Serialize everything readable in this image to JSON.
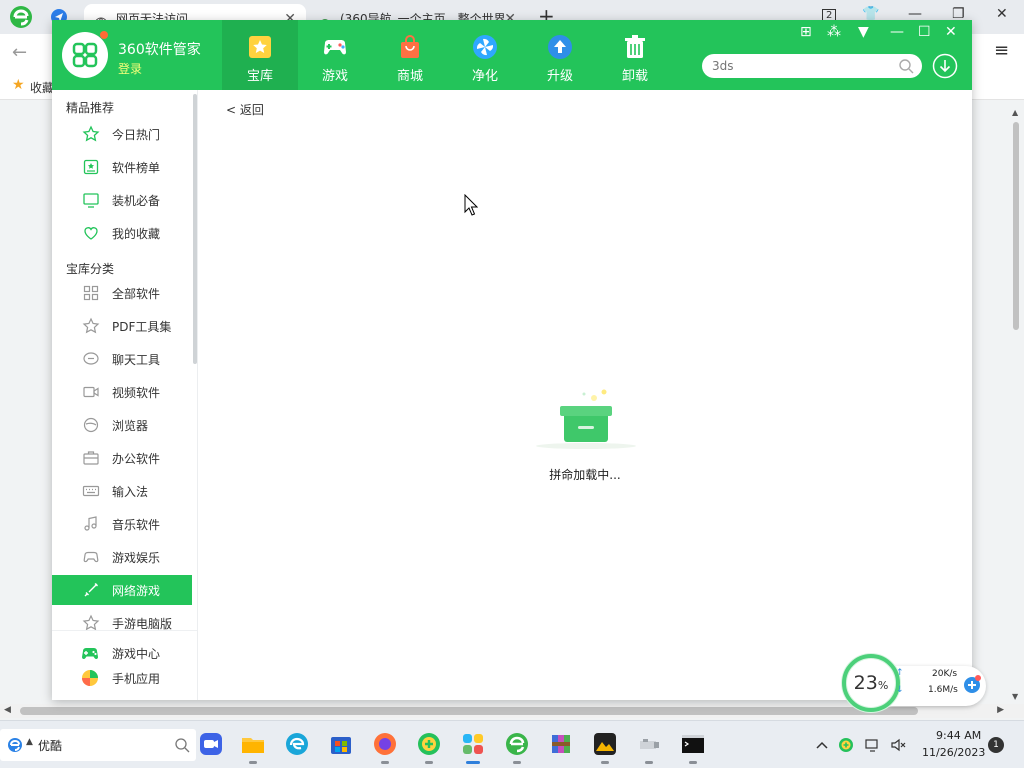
{
  "browser": {
    "tabs": [
      {
        "title": "网页无法访问",
        "active": true
      },
      {
        "title": "(360导航_一个主页，整个世界",
        "active": false
      }
    ],
    "tab_count_badge": "2",
    "bookmark_label": "收藏"
  },
  "app": {
    "title": "360软件管家",
    "login": "登录",
    "nav": [
      {
        "label": "宝库",
        "icon": "star-box-icon",
        "active": true
      },
      {
        "label": "游戏",
        "icon": "gamepad-icon",
        "active": false
      },
      {
        "label": "商城",
        "icon": "shopping-bag-icon",
        "active": false
      },
      {
        "label": "净化",
        "icon": "fan-icon",
        "active": false
      },
      {
        "label": "升级",
        "icon": "upgrade-arrow-icon",
        "active": false
      },
      {
        "label": "卸载",
        "icon": "trash-icon",
        "active": false
      }
    ],
    "search_placeholder": "3ds",
    "window_controls": [
      "grid-icon",
      "apps-icon",
      "dropdown-icon",
      "minimize-icon",
      "maximize-icon",
      "close-icon"
    ]
  },
  "sidebar": {
    "section1": "精品推荐",
    "section2": "宝库分类",
    "items1": [
      {
        "label": "今日热门",
        "icon": "star-outline-icon"
      },
      {
        "label": "软件榜单",
        "icon": "ranking-icon"
      },
      {
        "label": "装机必备",
        "icon": "monitor-icon"
      },
      {
        "label": "我的收藏",
        "icon": "heart-icon"
      }
    ],
    "items2": [
      {
        "label": "全部软件",
        "icon": "grid-icon"
      },
      {
        "label": "PDF工具集",
        "icon": "star-outline-icon"
      },
      {
        "label": "聊天工具",
        "icon": "chat-icon"
      },
      {
        "label": "视频软件",
        "icon": "video-icon"
      },
      {
        "label": "浏览器",
        "icon": "browser-icon"
      },
      {
        "label": "办公软件",
        "icon": "briefcase-icon"
      },
      {
        "label": "输入法",
        "icon": "keyboard-icon"
      },
      {
        "label": "音乐软件",
        "icon": "music-icon"
      },
      {
        "label": "游戏娱乐",
        "icon": "gamepad-icon"
      },
      {
        "label": "网络游戏",
        "icon": "sword-icon",
        "active": true
      },
      {
        "label": "手游电脑版",
        "icon": "star-outline-icon"
      }
    ],
    "footer": [
      {
        "label": "游戏中心",
        "icon": "game-center-icon"
      },
      {
        "label": "手机应用",
        "icon": "mobile-apps-icon"
      }
    ]
  },
  "main": {
    "back_label": "< 返回",
    "loading_text": "拼命加载中..."
  },
  "speed_widget": {
    "percent": "23",
    "percent_unit": "%",
    "upload": "20K/s",
    "download": "1.6M/s"
  },
  "taskbar": {
    "search_label": "优酷",
    "apps": [
      "zoom-icon",
      "file-explorer-icon",
      "edge-icon",
      "store-icon",
      "firefox-icon",
      "360-add-icon",
      "360-manager-icon",
      "360-browser-icon",
      "winrar-icon",
      "mountain-app-icon",
      "usb-icon",
      "terminal-icon"
    ],
    "time": "9:44 AM",
    "date": "11/26/2023",
    "notification_count": "1"
  },
  "colors": {
    "accent_green": "#23c45a",
    "login_yellow": "#f7ff7a"
  }
}
